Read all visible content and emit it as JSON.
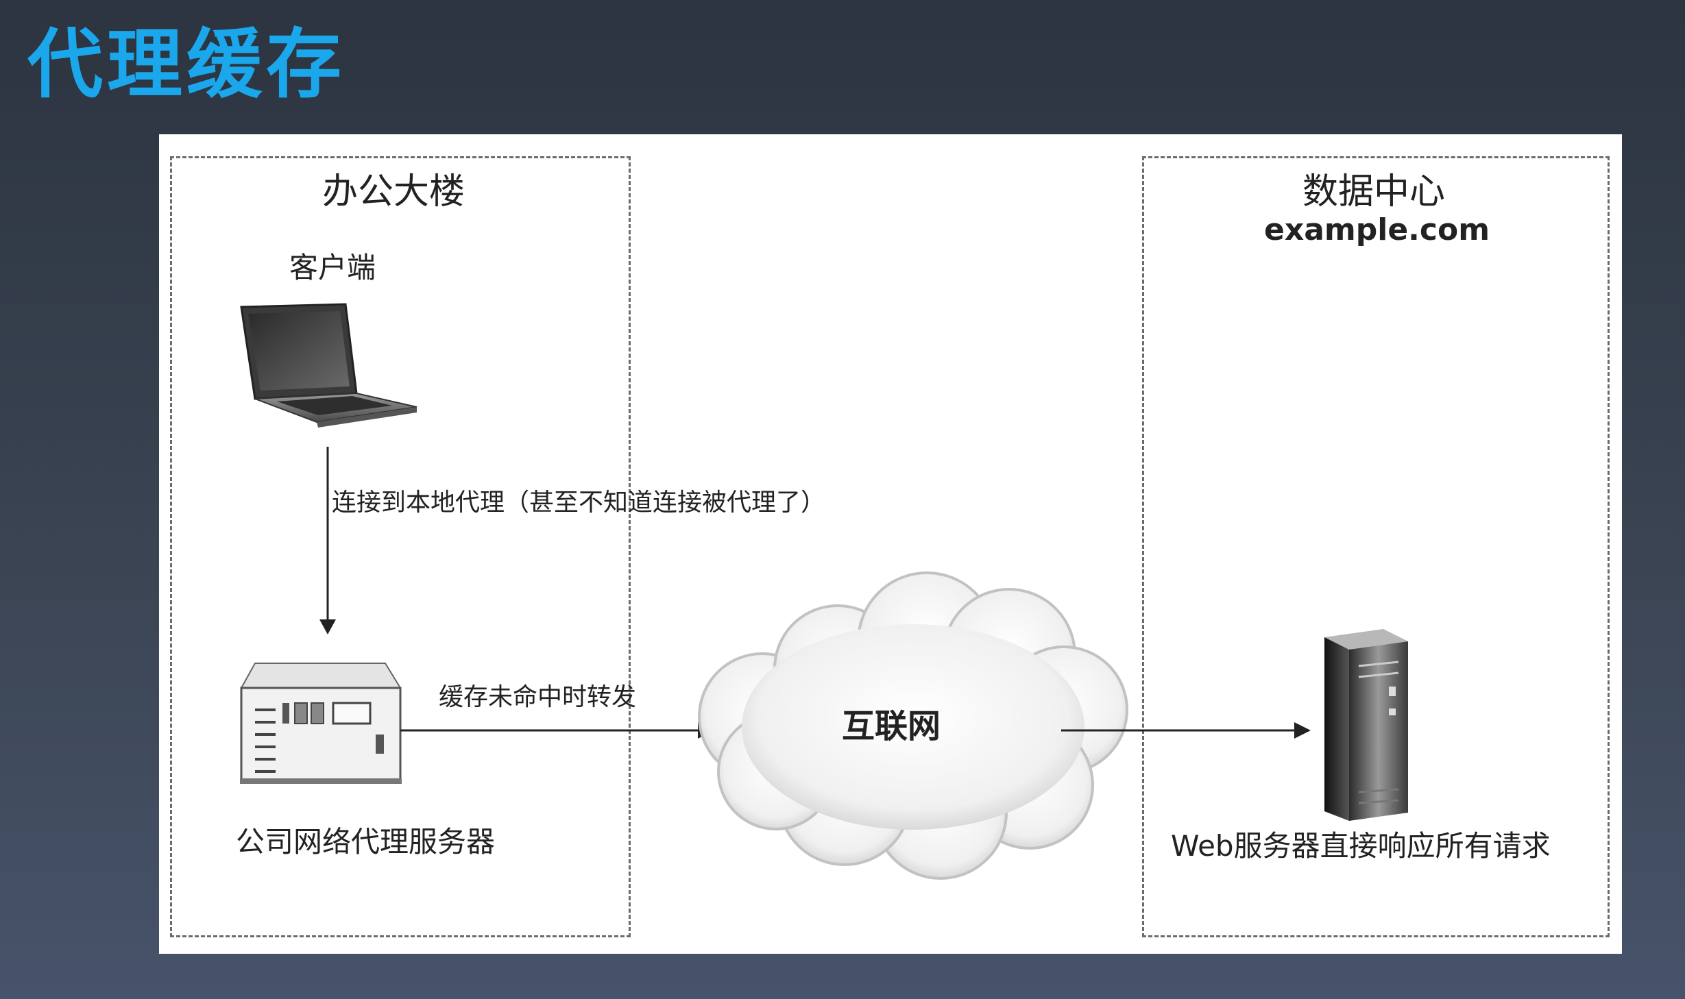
{
  "title": "代理缓存",
  "diagram": {
    "office": {
      "title": "办公大楼"
    },
    "datacenter": {
      "title": "数据中心",
      "domain": "example.com"
    },
    "client": {
      "label": "客户端"
    },
    "proxy": {
      "label": "公司网络代理服务器"
    },
    "internet": {
      "label": "互联网"
    },
    "webserver": {
      "label": "Web服务器直接响应所有请求"
    },
    "edges": {
      "client_to_proxy": "连接到本地代理（甚至不知道连接被代理了）",
      "proxy_to_internet": "缓存未命中时转发"
    }
  }
}
